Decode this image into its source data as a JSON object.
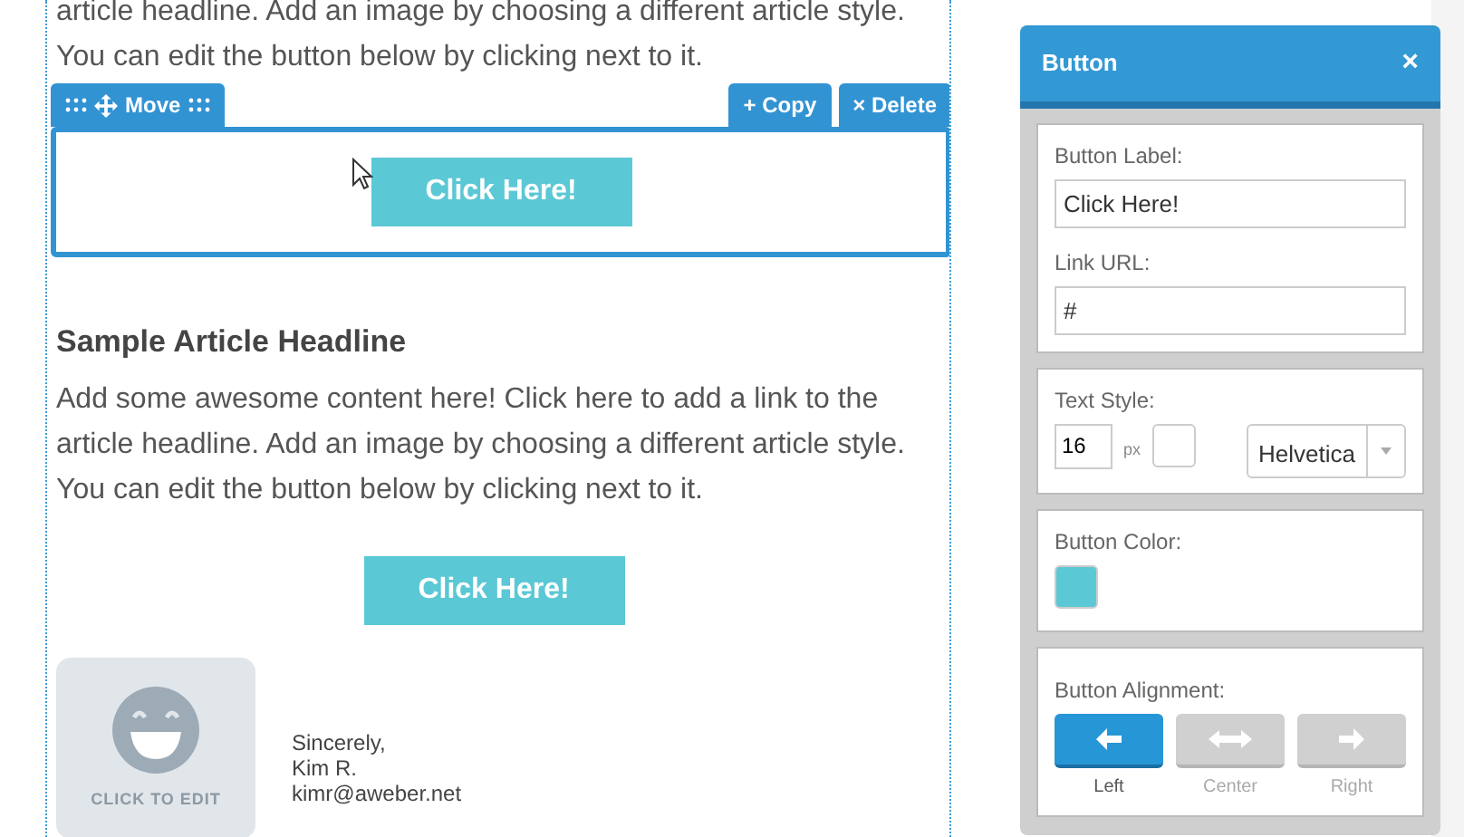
{
  "content": {
    "intro_paragraph": "article headline. Add an image by choosing a different article style. You can edit the button below by clicking next to it.",
    "editing_block": {
      "move_label": "Move",
      "copy_label": "+ Copy",
      "delete_label": "× Delete",
      "button_label": "Click Here!"
    },
    "headline": "Sample Article Headline",
    "paragraph": "Add some awesome content here! Click here to add a link to the article headline. Add an image by choosing a different article style. You can edit the button below by clicking next to it.",
    "button_label": "Click Here!",
    "signature": {
      "image_caption": "CLICK TO EDIT",
      "lines": [
        "Sincerely,",
        "Kim R.",
        "kimr@aweber.net"
      ]
    }
  },
  "panel": {
    "title": "Button",
    "close": "×",
    "button_label_field": {
      "label": "Button Label:",
      "value": "Click Here!"
    },
    "link_url_field": {
      "label": "Link URL:",
      "value": "#"
    },
    "text_style": {
      "label": "Text Style:",
      "size": "16",
      "unit": "px",
      "font": "Helvetica"
    },
    "button_color": {
      "label": "Button Color:",
      "color": "#5bc8d5"
    },
    "alignment": {
      "label": "Button Alignment:",
      "options": [
        {
          "kind": "left",
          "label": "Left",
          "selected": true
        },
        {
          "kind": "center",
          "label": "Center",
          "selected": false
        },
        {
          "kind": "right",
          "label": "Right",
          "selected": false
        }
      ]
    }
  }
}
